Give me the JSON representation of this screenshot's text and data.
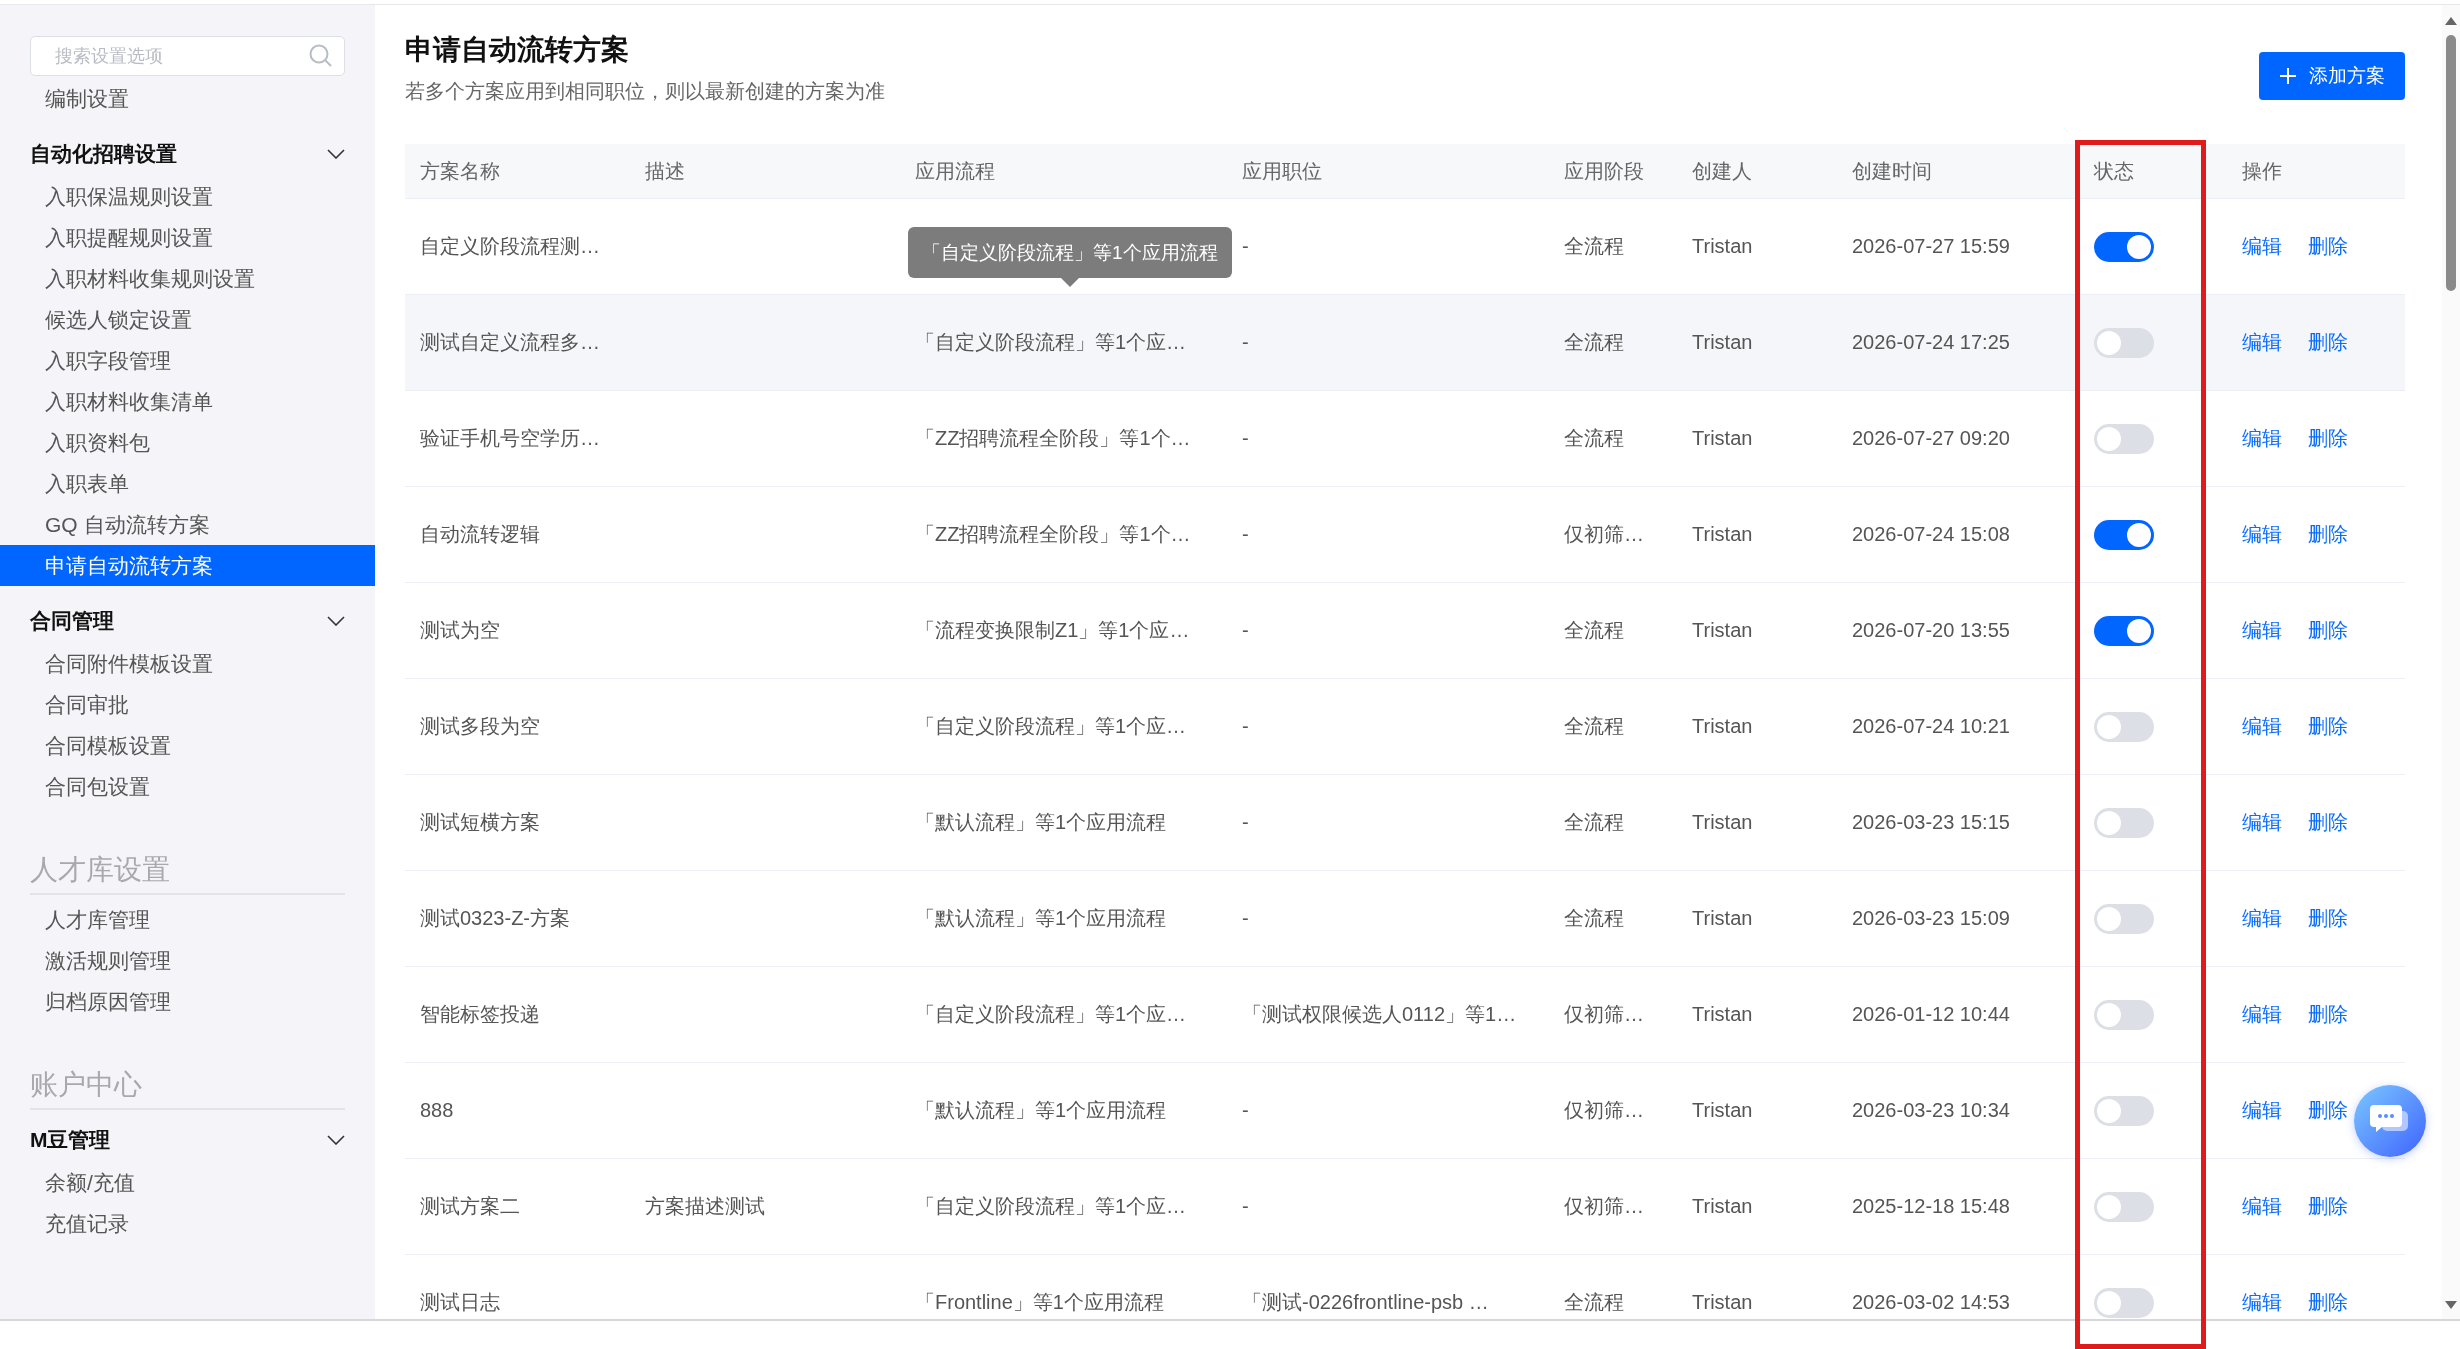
{
  "sidebar": {
    "search": {
      "placeholder": "搜索设置选项"
    },
    "items": [
      {
        "kind": "link",
        "label": "编制设置",
        "selected": false
      },
      {
        "kind": "group",
        "label": "自动化招聘设置",
        "expanded": true,
        "children": [
          {
            "kind": "link",
            "label": "入职保温规则设置",
            "selected": false
          },
          {
            "kind": "link",
            "label": "入职提醒规则设置",
            "selected": false
          },
          {
            "kind": "link",
            "label": "入职材料收集规则设置",
            "selected": false
          },
          {
            "kind": "link",
            "label": "候选人锁定设置",
            "selected": false
          },
          {
            "kind": "link",
            "label": "入职字段管理",
            "selected": false
          },
          {
            "kind": "link",
            "label": "入职材料收集清单",
            "selected": false
          },
          {
            "kind": "link",
            "label": "入职资料包",
            "selected": false
          },
          {
            "kind": "link",
            "label": "入职表单",
            "selected": false
          },
          {
            "kind": "link",
            "label": "GQ 自动流转方案",
            "selected": false
          },
          {
            "kind": "link",
            "label": "申请自动流转方案",
            "selected": true
          }
        ]
      },
      {
        "kind": "group",
        "label": "合同管理",
        "expanded": true,
        "children": [
          {
            "kind": "link",
            "label": "合同附件模板设置",
            "selected": false
          },
          {
            "kind": "link",
            "label": "合同审批",
            "selected": false
          },
          {
            "kind": "link",
            "label": "合同模板设置",
            "selected": false
          },
          {
            "kind": "link",
            "label": "合同包设置",
            "selected": false
          }
        ]
      },
      {
        "kind": "section",
        "label": "人才库设置",
        "children": [
          {
            "kind": "link",
            "label": "人才库管理",
            "selected": false
          },
          {
            "kind": "link",
            "label": "激活规则管理",
            "selected": false
          },
          {
            "kind": "link",
            "label": "归档原因管理",
            "selected": false
          }
        ]
      },
      {
        "kind": "section",
        "label": "账户中心",
        "children": [
          {
            "kind": "group",
            "label": "M豆管理",
            "expanded": true,
            "children": [
              {
                "kind": "link",
                "label": "余额/充值",
                "selected": false
              },
              {
                "kind": "link",
                "label": "充值记录",
                "selected": false
              }
            ]
          }
        ]
      }
    ]
  },
  "page": {
    "title": "申请自动流转方案",
    "subtitle": "若多个方案应用到相同职位，则以最新创建的方案为准",
    "add_button": "添加方案"
  },
  "table": {
    "columns": [
      {
        "label": "方案名称",
        "highlighted": false
      },
      {
        "label": "描述",
        "highlighted": false
      },
      {
        "label": "应用流程",
        "highlighted": false
      },
      {
        "label": "应用职位",
        "highlighted": false
      },
      {
        "label": "应用阶段",
        "highlighted": false
      },
      {
        "label": "创建人",
        "highlighted": false
      },
      {
        "label": "创建时间",
        "highlighted": false
      },
      {
        "label": "状态",
        "highlighted": true
      },
      {
        "label": "操作",
        "highlighted": false
      }
    ],
    "rows": [
      {
        "name": "自定义阶段流程测…",
        "flow_tooltip": "「自定义阶段流程」等1个应用流程",
        "position": "-",
        "stage": "全流程",
        "creator": "Tristan",
        "created": "2026-07-27 15:59",
        "enabled": true,
        "hovered": false,
        "actions": [
          "编辑",
          "删除"
        ]
      },
      {
        "name": "测试自定义流程多…",
        "flow": "「自定义阶段流程」等1个应…",
        "position": "-",
        "stage": "全流程",
        "creator": "Tristan",
        "created": "2026-07-24 17:25",
        "enabled": false,
        "hovered": true,
        "actions": [
          "编辑",
          "删除"
        ]
      },
      {
        "name": "验证手机号空学历…",
        "flow": "「ZZ招聘流程全阶段」等1个…",
        "position": "-",
        "stage": "全流程",
        "creator": "Tristan",
        "created": "2026-07-27 09:20",
        "enabled": false,
        "hovered": false,
        "actions": [
          "编辑",
          "删除"
        ]
      },
      {
        "name": "自动流转逻辑",
        "flow": "「ZZ招聘流程全阶段」等1个…",
        "position": "-",
        "stage": "仅初筛…",
        "creator": "Tristan",
        "created": "2026-07-24 15:08",
        "enabled": true,
        "hovered": false,
        "actions": [
          "编辑",
          "删除"
        ]
      },
      {
        "name": "测试为空",
        "flow": "「流程变换限制Z1」等1个应…",
        "position": "-",
        "stage": "全流程",
        "creator": "Tristan",
        "created": "2026-07-20 13:55",
        "enabled": true,
        "hovered": false,
        "actions": [
          "编辑",
          "删除"
        ]
      },
      {
        "name": "测试多段为空",
        "flow": "「自定义阶段流程」等1个应…",
        "position": "-",
        "stage": "全流程",
        "creator": "Tristan",
        "created": "2026-07-24 10:21",
        "enabled": false,
        "hovered": false,
        "actions": [
          "编辑",
          "删除"
        ]
      },
      {
        "name": "测试短横方案",
        "flow": "「默认流程」等1个应用流程",
        "position": "-",
        "stage": "全流程",
        "creator": "Tristan",
        "created": "2026-03-23 15:15",
        "enabled": false,
        "hovered": false,
        "actions": [
          "编辑",
          "删除"
        ]
      },
      {
        "name": "测试0323-Z-方案",
        "flow": "「默认流程」等1个应用流程",
        "position": "-",
        "stage": "全流程",
        "creator": "Tristan",
        "created": "2026-03-23 15:09",
        "enabled": false,
        "hovered": false,
        "actions": [
          "编辑",
          "删除"
        ]
      },
      {
        "name": "智能标签投递",
        "flow": "「自定义阶段流程」等1个应…",
        "position": "「测试权限候选人0112」等1…",
        "stage": "仅初筛…",
        "creator": "Tristan",
        "created": "2026-01-12 10:44",
        "enabled": false,
        "hovered": false,
        "actions": [
          "编辑",
          "删除"
        ]
      },
      {
        "name": "888",
        "flow": "「默认流程」等1个应用流程",
        "position": "-",
        "stage": "仅初筛…",
        "creator": "Tristan",
        "created": "2026-03-23 10:34",
        "enabled": false,
        "hovered": false,
        "actions": [
          "编辑",
          "删除"
        ]
      },
      {
        "name": "测试方案二",
        "description": "方案描述测试",
        "flow": "「自定义阶段流程」等1个应…",
        "position": "-",
        "stage": "仅初筛…",
        "creator": "Tristan",
        "created": "2025-12-18 15:48",
        "enabled": false,
        "hovered": false,
        "actions": [
          "编辑",
          "删除"
        ]
      },
      {
        "name": "测试日志",
        "flow": "「Frontline」等1个应用流程",
        "position": "「测试-0226frontline-psb …",
        "stage": "全流程",
        "creator": "Tristan",
        "created": "2026-03-02 14:53",
        "enabled": false,
        "hovered": false,
        "actions": [
          "编辑",
          "删除"
        ]
      }
    ]
  }
}
